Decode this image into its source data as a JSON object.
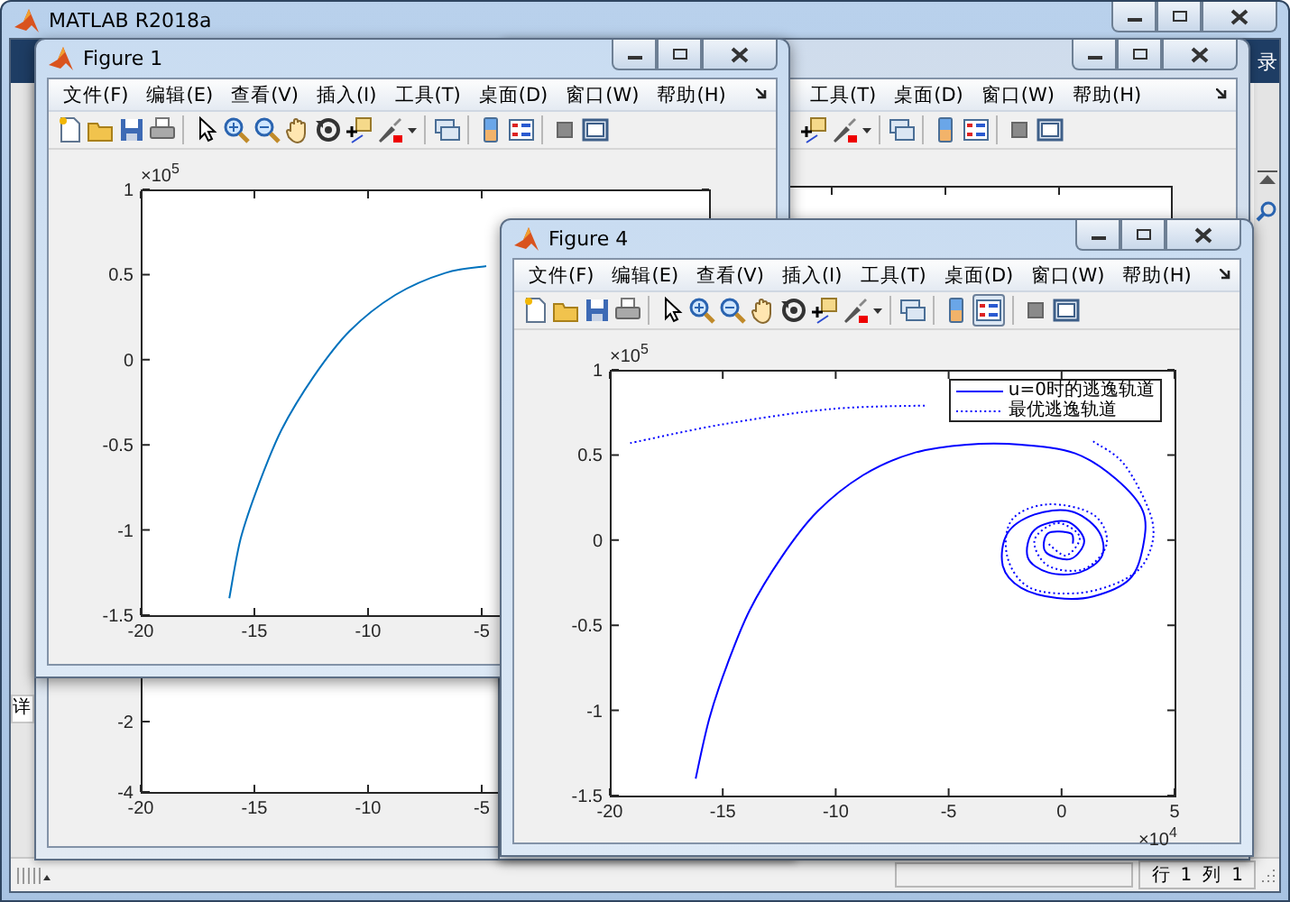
{
  "app": {
    "title": "MATLAB R2018a",
    "toolstrip_text": "录",
    "side_tab": "详"
  },
  "figures": [
    {
      "kind": "back",
      "axes": {
        "xticks": [
          "-20",
          "-15",
          "-10",
          "-5"
        ],
        "yticks": [
          "-2",
          "-4"
        ]
      }
    },
    {
      "kind": "back",
      "menu": [
        "工具(T)",
        "桌面(D)",
        "窗口(W)",
        "帮助(H)"
      ],
      "legend_pressed": false
    },
    {
      "kind": "front",
      "title": "Figure 1",
      "menu": [
        "文件(F)",
        "编辑(E)",
        "查看(V)",
        "插入(I)",
        "工具(T)",
        "桌面(D)",
        "窗口(W)",
        "帮助(H)"
      ],
      "legend_pressed": false,
      "y_multiplier": "×10$^{5}$",
      "chart_data": {
        "type": "line",
        "xlim": [
          -20,
          5
        ],
        "ylim": [
          -1.5,
          1
        ],
        "xticks": [
          -20,
          -15,
          -10,
          -5
        ],
        "yticks": [
          1,
          0.5,
          0,
          -0.5,
          -1,
          -1.5
        ],
        "series": [
          {
            "line_style": "solid",
            "color": "#0072bd",
            "x": [
              -16.1,
              -15.6,
              -14.8,
              -13.8,
              -12.4,
              -10.8,
              -8.8,
              -6.6,
              -4.8
            ],
            "values": [
              -1.4,
              -1.05,
              -0.73,
              -0.41,
              -0.1,
              0.17,
              0.38,
              0.51,
              0.55
            ]
          }
        ]
      }
    },
    {
      "kind": "front",
      "title": "Figure 4",
      "menu": [
        "文件(F)",
        "编辑(E)",
        "查看(V)",
        "插入(I)",
        "工具(T)",
        "桌面(D)",
        "窗口(W)",
        "帮助(H)"
      ],
      "legend_pressed": true,
      "y_multiplier": "×10$^{5}$",
      "x_multiplier": "×10$^{4}$",
      "chart_data": {
        "type": "line",
        "xlim": [
          -20,
          5
        ],
        "ylim": [
          -1.5,
          1
        ],
        "xticks": [
          -20,
          -15,
          -10,
          -5,
          0,
          5
        ],
        "yticks": [
          1,
          0.5,
          0,
          -0.5,
          -1,
          -1.5
        ],
        "series": [
          {
            "name": "u=0时的逃逸轨道",
            "line_style": "solid",
            "color": "#0000ff",
            "x": [
              -16.2,
              -15.6,
              -14.8,
              -13.8,
              -12.4,
              -10.8,
              -8.8,
              -6.6,
              -4.2,
              -1.8,
              0.6,
              2.4,
              3.6,
              3.6,
              3.0,
              1.4,
              -0.2,
              -1.8,
              -2.6,
              -2.4,
              -1.2,
              0.4,
              1.6,
              1.8,
              0.8,
              -0.6,
              -1.5,
              -1.2,
              0.2,
              1.0,
              0.4,
              -0.7,
              -0.6,
              0.4,
              0.5
            ],
            "values": [
              -1.4,
              -1.05,
              -0.73,
              -0.41,
              -0.1,
              0.17,
              0.38,
              0.51,
              0.56,
              0.56,
              0.51,
              0.36,
              0.17,
              -0.04,
              -0.23,
              -0.33,
              -0.34,
              -0.28,
              -0.15,
              0.04,
              0.15,
              0.17,
              0.06,
              -0.09,
              -0.19,
              -0.19,
              -0.1,
              0.06,
              0.11,
              0,
              -0.11,
              -0.07,
              0.04,
              0.04,
              -0.02
            ]
          },
          {
            "name": "最优逃逸轨道",
            "line_style": "dotted",
            "color": "#0000ff",
            "x": [
              -19.1,
              -15.0,
              -10.2,
              -6.0,
              -4.6,
              0.0,
              1.4,
              2.8,
              4.0,
              3.8,
              2.8,
              0.8,
              -1.4,
              -2.4,
              -2.2,
              -0.6,
              1.4,
              2.0,
              1.0,
              -0.6,
              -1.2,
              -0.2,
              0.8,
              0.2,
              -0.6
            ],
            "values": [
              0.57,
              0.68,
              0.77,
              0.79,
              null,
              null,
              0.58,
              0.44,
              0.12,
              -0.1,
              -0.23,
              -0.31,
              -0.28,
              -0.1,
              0.12,
              0.21,
              0.15,
              -0.02,
              -0.17,
              -0.15,
              0,
              0.1,
              0.02,
              -0.09,
              -0.02
            ]
          }
        ]
      }
    }
  ],
  "status_bar": {
    "line_label": "行",
    "line": "1",
    "column_label": "列",
    "column": "1"
  }
}
